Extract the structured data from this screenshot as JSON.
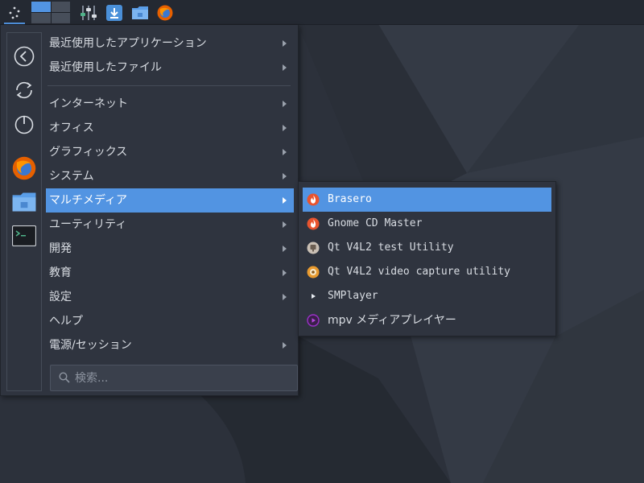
{
  "panel": {
    "launcher_icon": "application-menu-icon",
    "workspaces": [
      {
        "active": true
      },
      {
        "active": false
      },
      {
        "active": false
      },
      {
        "active": false
      }
    ],
    "quicklaunch": [
      "mixer-icon",
      "download-icon",
      "folder-icon",
      "firefox-icon"
    ]
  },
  "sidebar": {
    "buttons": [
      "back-icon",
      "refresh-icon",
      "power-icon",
      "firefox-icon",
      "folder-icon",
      "terminal-icon"
    ]
  },
  "menu": {
    "categories": [
      {
        "label": "最近使用したアプリケーション",
        "arrow": true
      },
      {
        "label": "最近使用したファイル",
        "arrow": true
      },
      {
        "label": "インターネット",
        "arrow": true
      },
      {
        "label": "オフィス",
        "arrow": true
      },
      {
        "label": "グラフィックス",
        "arrow": true
      },
      {
        "label": "システム",
        "arrow": true
      },
      {
        "label": "マルチメディア",
        "arrow": true,
        "active": true
      },
      {
        "label": "ユーティリティ",
        "arrow": true
      },
      {
        "label": "開発",
        "arrow": true
      },
      {
        "label": "教育",
        "arrow": true
      },
      {
        "label": "設定",
        "arrow": true
      },
      {
        "label": "ヘルプ",
        "arrow": false
      },
      {
        "label": "電源/セッション",
        "arrow": true
      }
    ],
    "search_placeholder": "検索..."
  },
  "submenu": {
    "items": [
      {
        "label": "Brasero",
        "icon": "brasero-icon",
        "active": true
      },
      {
        "label": "Gnome CD Master",
        "icon": "gnome-cd-master-icon"
      },
      {
        "label": "Qt V4L2 test Utility",
        "icon": "qv4l2-icon"
      },
      {
        "label": "Qt V4L2 video capture utility",
        "icon": "qvidcap-icon"
      },
      {
        "label": "SMPlayer",
        "icon": "smplayer-icon"
      },
      {
        "label": "mpv メディアプレイヤー",
        "icon": "mpv-icon"
      }
    ]
  },
  "colors": {
    "accent": "#5294e2",
    "menu_bg": "#2f343f",
    "panel_bg": "#242932",
    "text": "#d8dce2"
  }
}
